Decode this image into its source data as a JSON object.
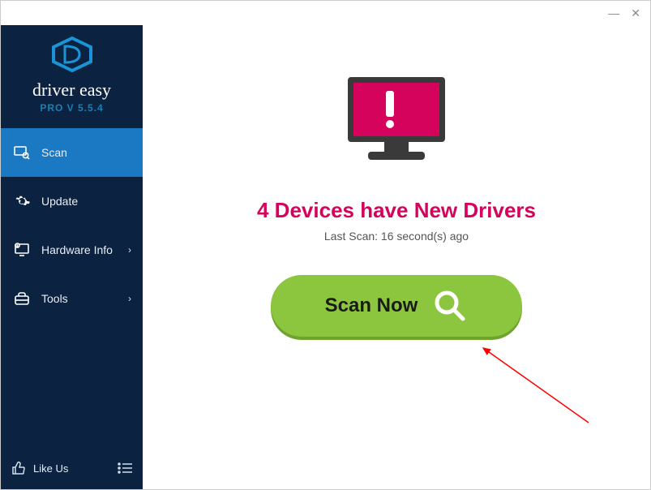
{
  "brand": {
    "name": "driver easy",
    "version": "PRO V 5.5.4"
  },
  "sidebar": {
    "scan": "Scan",
    "update": "Update",
    "hardware": "Hardware Info",
    "tools": "Tools",
    "likeus": "Like Us"
  },
  "main": {
    "headline": "4 Devices have New Drivers",
    "last_scan": "Last Scan: 16 second(s) ago",
    "scan_button": "Scan Now"
  }
}
